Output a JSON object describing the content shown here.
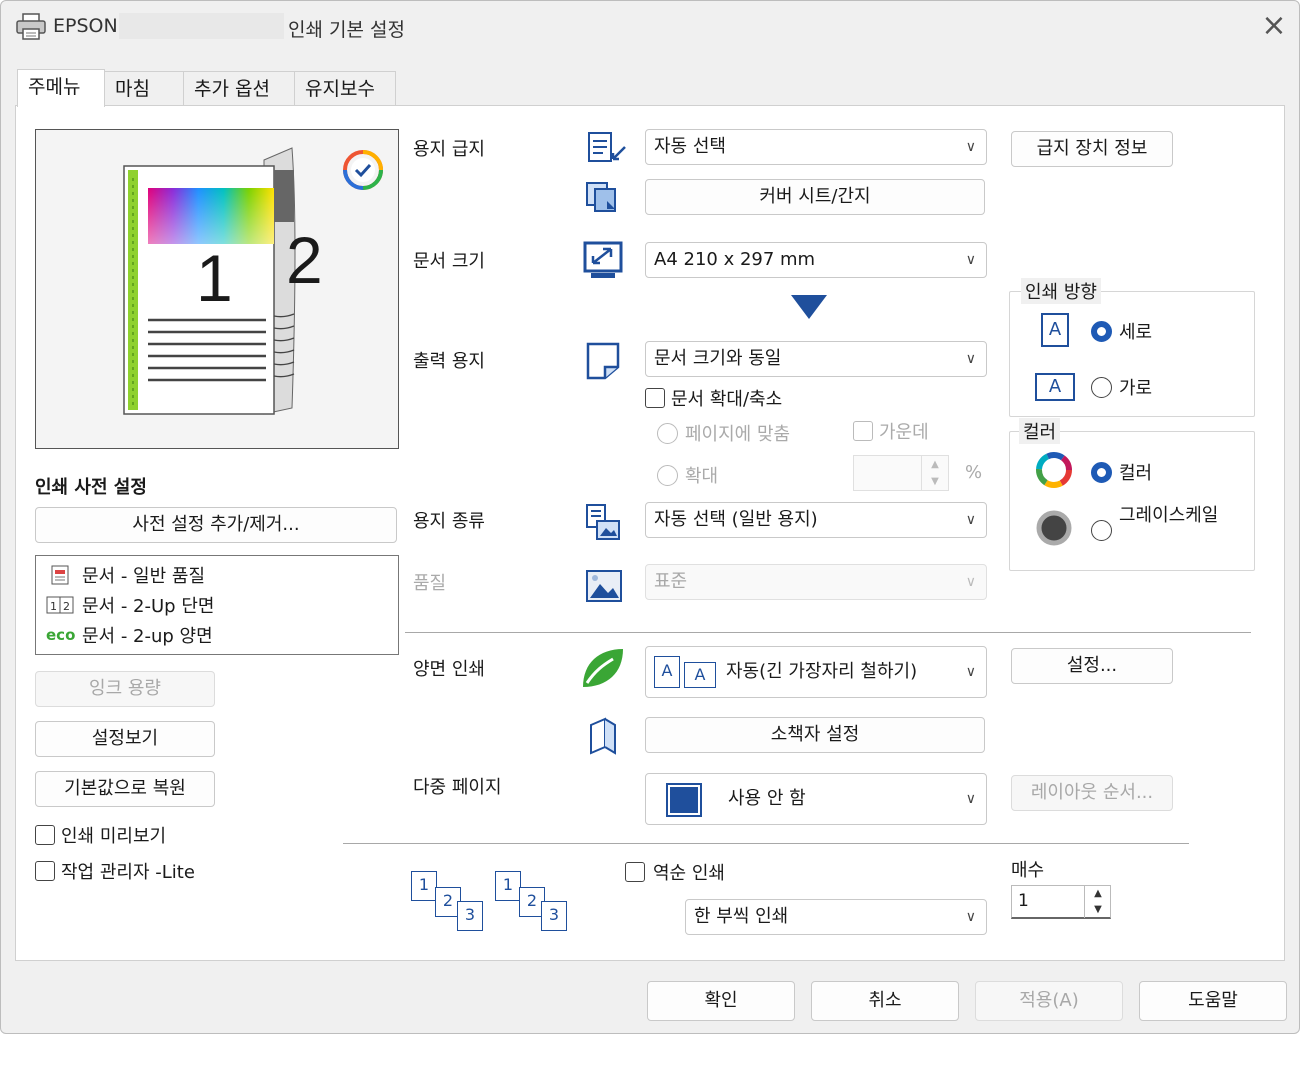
{
  "window": {
    "brand": "EPSON",
    "title": "인쇄 기본 설정",
    "close_label": "×"
  },
  "tabs": [
    "주메뉴",
    "마침",
    "추가 옵션",
    "유지보수"
  ],
  "preview": {
    "page1": "1",
    "page2": "2"
  },
  "presets": {
    "title": "인쇄 사전 설정",
    "add_remove": "사전 설정 추가/제거...",
    "items": [
      {
        "icon": "document-icon",
        "label": "문서 - 일반 품질"
      },
      {
        "icon": "two-up-icon",
        "label": "문서 - 2-Up 단면"
      },
      {
        "icon": "eco-icon",
        "label": "문서 - 2-up 양면"
      }
    ],
    "eco_text": "eco"
  },
  "left_buttons": {
    "ink_levels": "잉크 용량",
    "show_settings": "설정보기",
    "restore_defaults": "기본값으로 복원"
  },
  "left_checks": {
    "print_preview": "인쇄 미리보기",
    "job_arranger": "작업 관리자 -Lite"
  },
  "paper_source": {
    "label": "용지 급지",
    "value": "자동 선택",
    "cover_sheet": "커버 시트/간지",
    "info": "급지 장치 정보"
  },
  "document_size": {
    "label": "문서 크기",
    "value": "A4 210 x 297 mm"
  },
  "output_paper": {
    "label": "출력 용지",
    "value": "문서 크기와 동일",
    "reduce_enlarge": "문서 확대/축소",
    "fit_to_page": "페이지에 맞춤",
    "center": "가운데",
    "zoom": "확대",
    "percent": "%"
  },
  "orientation": {
    "title": "인쇄 방향",
    "portrait": "세로",
    "landscape": "가로",
    "icon_letter": "A"
  },
  "color": {
    "title": "컬러",
    "color": "컬러",
    "grayscale": "그레이스케일"
  },
  "paper_type": {
    "label": "용지 종류",
    "value": "자동 선택 (일반 용지)"
  },
  "quality": {
    "label": "품질",
    "value": "표준"
  },
  "duplex": {
    "label": "양면 인쇄",
    "value": "자동(긴 가장자리 철하기)",
    "settings": "설정...",
    "booklet": "소책자 설정",
    "icon_letter": "A"
  },
  "multi_page": {
    "label": "다중 페이지",
    "value": "사용 안 함",
    "layout_order": "레이아웃 순서..."
  },
  "copies": {
    "reverse_order": "역순 인쇄",
    "collate": "한 부씩 인쇄",
    "copies_label": "매수",
    "copies_value": "1",
    "collate_nums": [
      "1",
      "2",
      "3"
    ]
  },
  "footer": {
    "ok": "확인",
    "cancel": "취소",
    "apply": "적용(A)",
    "help": "도움말"
  },
  "colors": {
    "accent": "#1e5ab5",
    "eco_green": "#3aa635",
    "icon_blue": "#1f4f9c"
  }
}
